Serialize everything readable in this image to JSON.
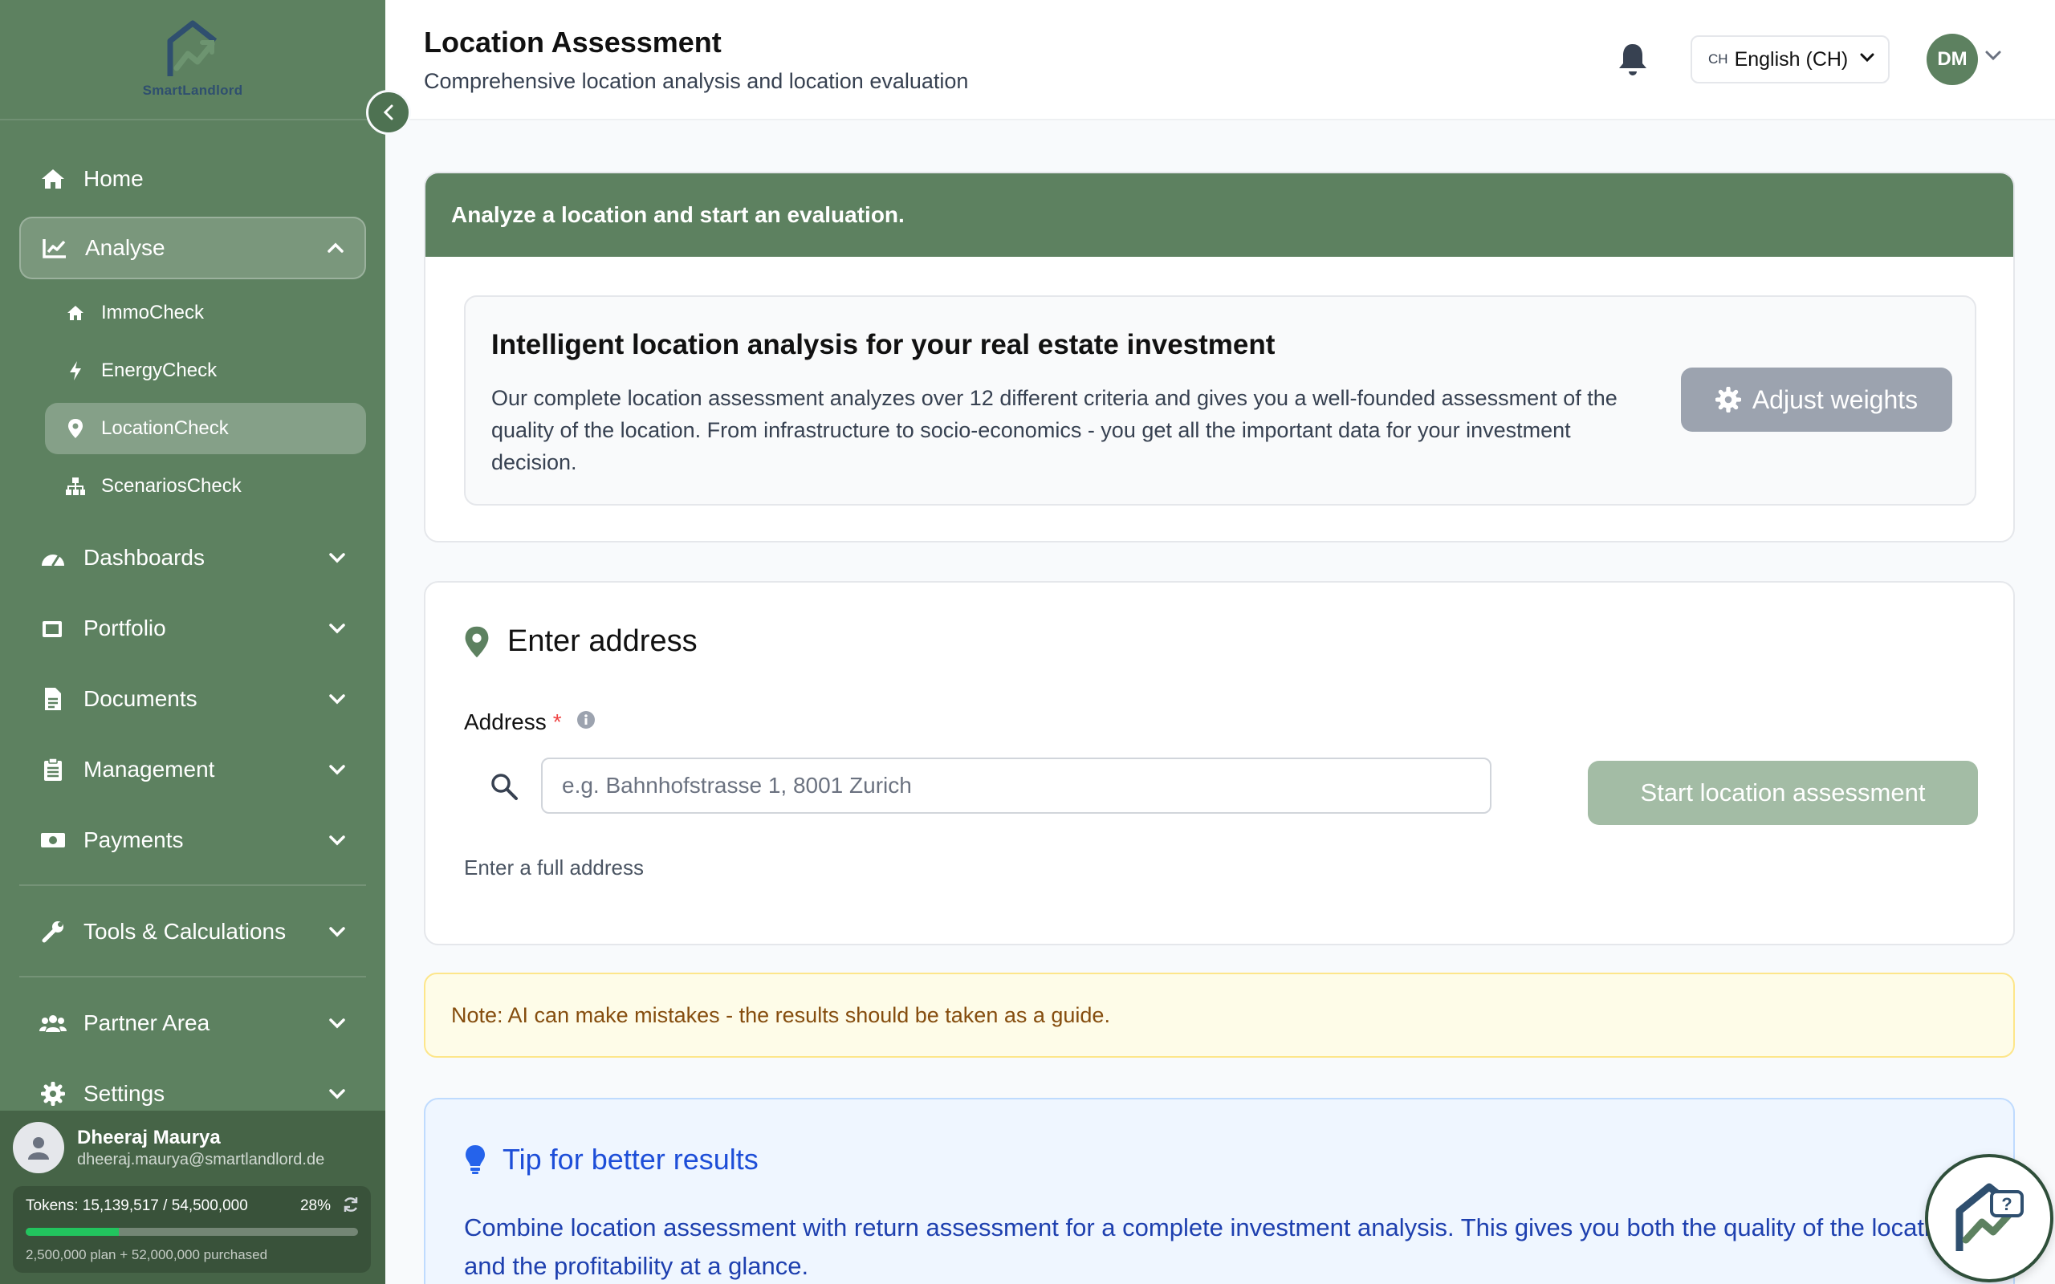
{
  "brand": {
    "name": "SmartLandlord"
  },
  "sidebar": {
    "items": [
      {
        "label": "Home",
        "icon": "home-icon"
      },
      {
        "label": "Analyse",
        "icon": "chart-line-icon",
        "expanded": true
      },
      {
        "label": "Dashboards",
        "icon": "gauge-icon"
      },
      {
        "label": "Portfolio",
        "icon": "folder-icon"
      },
      {
        "label": "Documents",
        "icon": "document-icon"
      },
      {
        "label": "Management",
        "icon": "clipboard-icon"
      },
      {
        "label": "Payments",
        "icon": "money-icon"
      },
      {
        "label": "Tools & Calculations",
        "icon": "wrench-icon"
      },
      {
        "label": "Partner Area",
        "icon": "users-icon"
      },
      {
        "label": "Settings",
        "icon": "gear-icon"
      }
    ],
    "sub_items": [
      {
        "label": "ImmoCheck",
        "icon": "house-icon"
      },
      {
        "label": "EnergyCheck",
        "icon": "bolt-icon"
      },
      {
        "label": "LocationCheck",
        "icon": "map-pin-icon",
        "active": true
      },
      {
        "label": "ScenariosCheck",
        "icon": "sitemap-icon"
      }
    ]
  },
  "user": {
    "name": "Dheeraj Maurya",
    "email": "dheeraj.maurya@smartlandlord.de",
    "tokens_text": "Tokens: 15,139,517 / 54,500,000",
    "tokens_pct": "28%",
    "tokens_fraction": 0.28,
    "tokens_sub": "2,500,000 plan + 52,000,000 purchased"
  },
  "header": {
    "title": "Location Assessment",
    "subtitle": "Comprehensive location analysis and location evaluation",
    "lang_code": "CH",
    "lang_label": "English (CH)",
    "avatar_initials": "DM"
  },
  "intro": {
    "banner": "Analyze a location and start an evaluation.",
    "title": "Intelligent location analysis for your real estate investment",
    "text": "Our complete location assessment analyzes over 12 different criteria and gives you a well-founded assessment of the quality of the location. From infrastructure to socio-economics - you get all the important data for your investment decision.",
    "adjust_button": "Adjust weights"
  },
  "address": {
    "section_title": "Enter address",
    "label": "Address",
    "required_mark": "*",
    "placeholder": "e.g. Bahnhofstrasse 1, 8001 Zurich",
    "value": "",
    "hint": "Enter a full address",
    "start_button": "Start location assessment"
  },
  "note": {
    "text": "Note: AI can make mistakes - the results should be taken as a guide."
  },
  "tip": {
    "title": "Tip for better results",
    "text": "Combine location assessment with return assessment for a complete investment analysis. This gives you both the quality of the location and the profitability at a glance."
  },
  "colors": {
    "sidebar": "#5d8160",
    "accent_green": "#5d8160",
    "tip_blue": "#1d4ed8",
    "note_text": "#854d0e"
  }
}
